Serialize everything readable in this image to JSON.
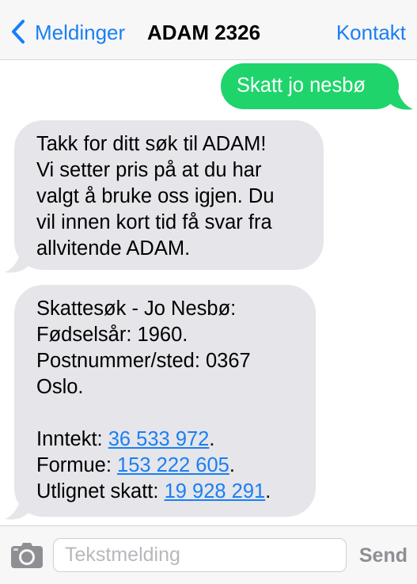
{
  "colors": {
    "accent": "#1a7ff3",
    "sent_bubble": "#1fd46b",
    "received_bubble": "#e5e5ea",
    "send_disabled": "#8e8e93"
  },
  "navbar": {
    "back_icon": "chevron-left-icon",
    "back_label": "Meldinger",
    "title": "ADAM 2326",
    "contact_label": "Kontakt"
  },
  "messages": {
    "sent": {
      "text": "Skatt jo nesbø"
    },
    "received_1": {
      "lines": [
        "Takk for ditt søk til ADAM!",
        "Vi setter pris på at du har",
        "valgt å bruke oss igjen. Du",
        "vil innen kort tid få svar fra",
        "allvitende ADAM."
      ]
    },
    "received_2": {
      "lines": [
        "Skattesøk - Jo Nesbø:",
        "Fødselsår: 1960.",
        "Postnummer/sted: 0367",
        "Oslo."
      ],
      "income_label": "Inntekt: ",
      "income_value": "36 533 972",
      "wealth_label": "Formue: ",
      "wealth_value": "153 222 605",
      "tax_label": "Utlignet skatt: ",
      "tax_value": "19 928 291",
      "period": "."
    }
  },
  "input_bar": {
    "camera_icon": "camera-icon",
    "placeholder": "Tekstmelding",
    "send_label": "Send"
  }
}
